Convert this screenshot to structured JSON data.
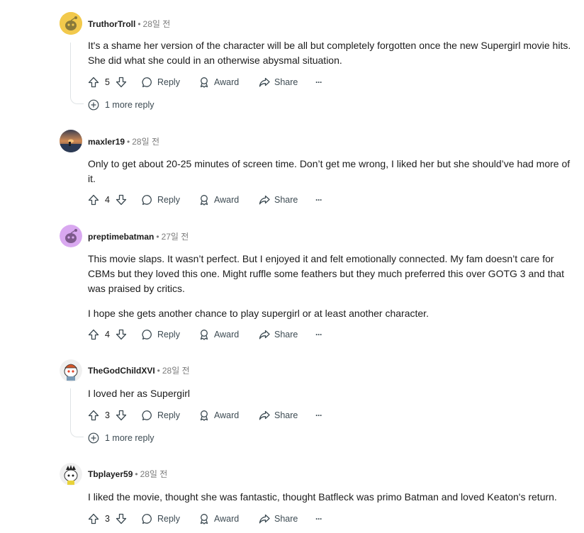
{
  "comments": [
    {
      "author": "TruthorTroll",
      "time": "28일 전",
      "paragraphs": [
        "It's a shame her version of the character will be all but completely forgotten once the new Supergirl movie hits. She did what she could in an otherwise abysmal situation."
      ],
      "score": "5",
      "more_reply": "1 more reply",
      "avatar": "snoo-yellow-avatar"
    },
    {
      "author": "maxler19",
      "time": "28일 전",
      "paragraphs": [
        "Only to get about 20-25 minutes of screen time. Don’t get me wrong, I liked her but she should’ve had more of it."
      ],
      "score": "4",
      "avatar": "sunset-photo-avatar"
    },
    {
      "author": "preptimebatman",
      "time": "27일 전",
      "paragraphs": [
        "This movie slaps. It wasn’t perfect. But I enjoyed it and felt emotionally connected. My fam doesn’t care for CBMs but they loved this one. Might ruffle some feathers but they much preferred this over GOTG 3 and that was praised by critics.",
        "I hope she gets another chance to play supergirl or at least another character."
      ],
      "score": "4",
      "avatar": "snoo-purple-avatar"
    },
    {
      "author": "TheGodChildXVI",
      "time": "28일 전",
      "paragraphs": [
        "I loved her as Supergirl"
      ],
      "score": "3",
      "more_reply": "1 more reply",
      "avatar": "snoo-custom-avatar"
    },
    {
      "author": "Tbplayer59",
      "time": "28일 전",
      "paragraphs": [
        "I liked the movie, thought she was fantastic, thought Batfleck was primo Batman and loved Keaton's return."
      ],
      "score": "3",
      "avatar": "snoo-custom-avatar-2"
    }
  ],
  "actions": {
    "reply": "Reply",
    "award": "Award",
    "share": "Share",
    "more": "···"
  },
  "colors": {
    "text": "#1c1c1c",
    "muted": "#7c7c7c",
    "icon": "#576f76"
  }
}
